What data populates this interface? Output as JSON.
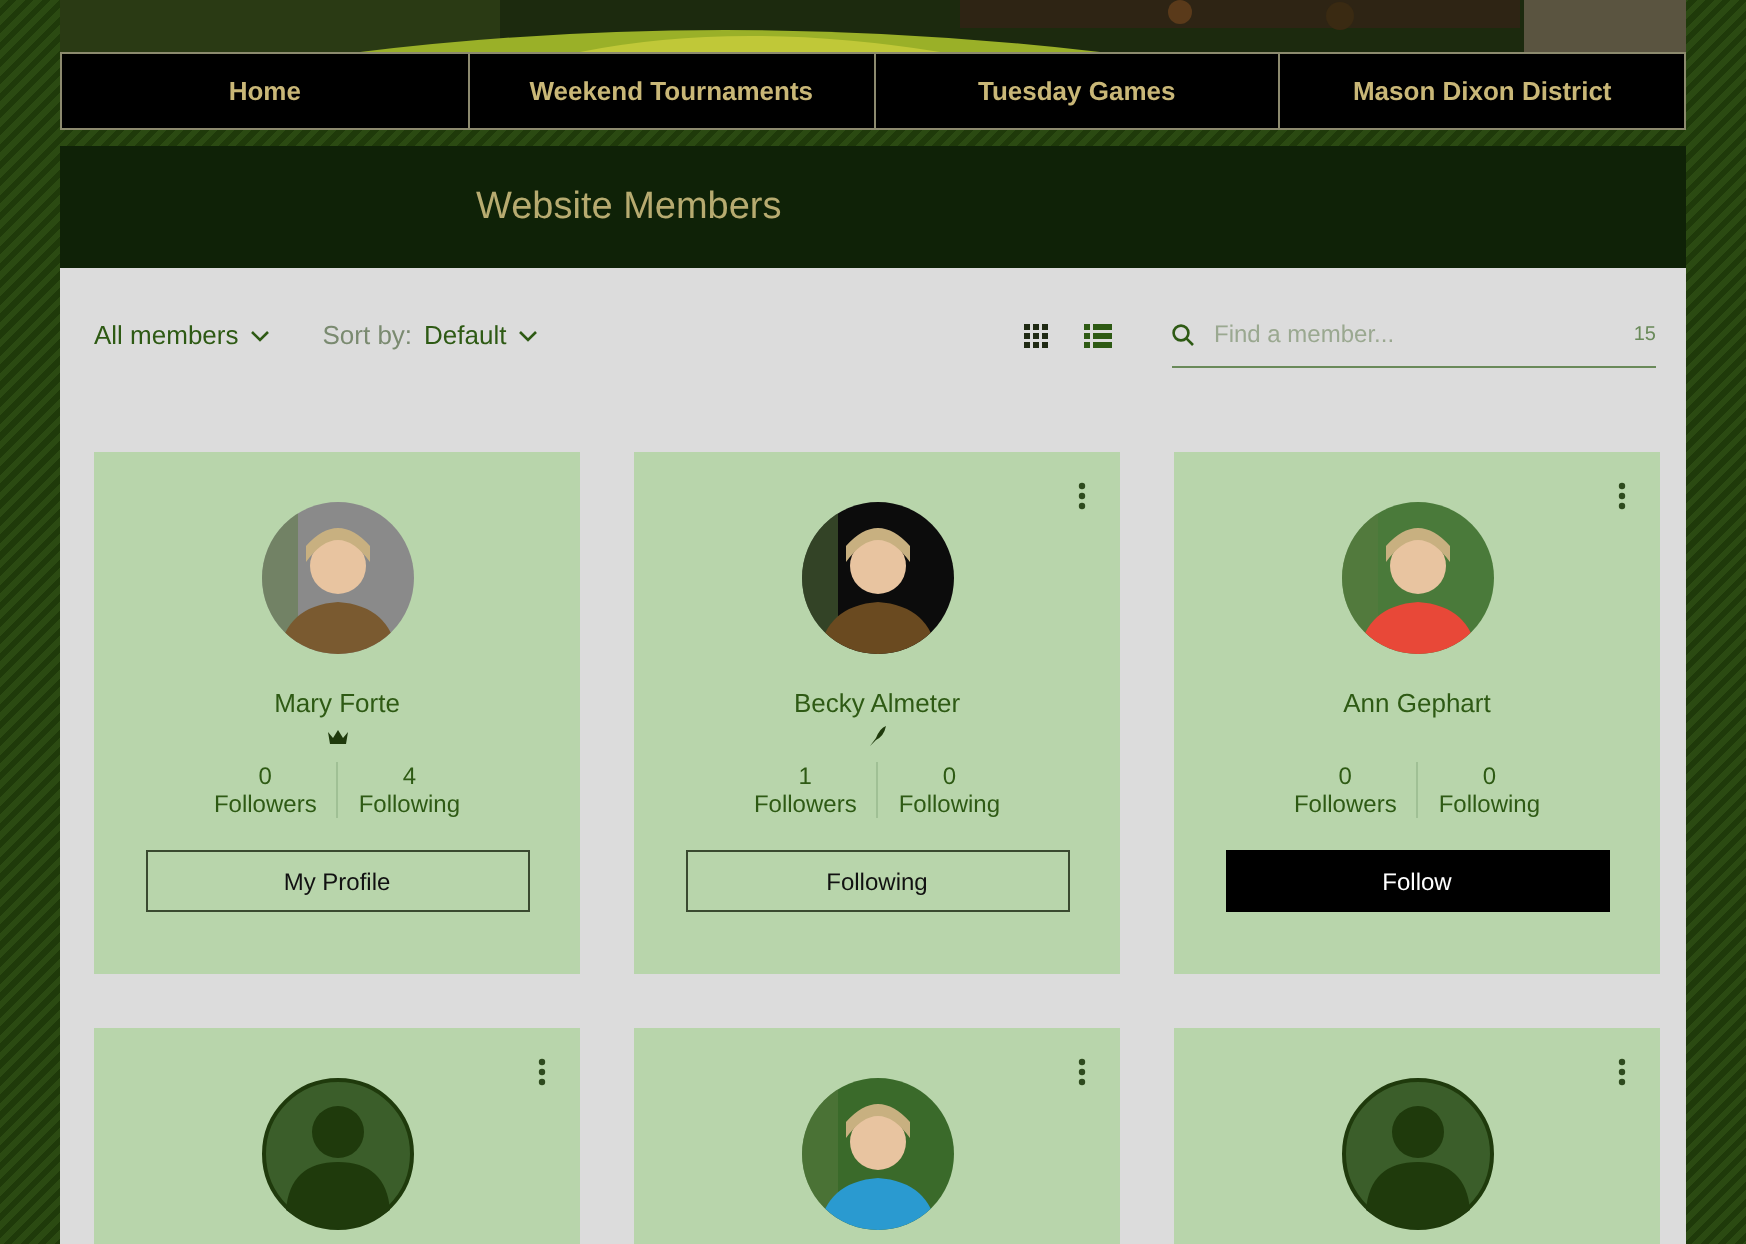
{
  "nav": [
    {
      "label": "Home"
    },
    {
      "label": "Weekend Tournaments"
    },
    {
      "label": "Tuesday Games"
    },
    {
      "label": "Mason Dixon District"
    }
  ],
  "header": {
    "title": "Website Members"
  },
  "toolbar": {
    "filter": "All members",
    "sort_label": "Sort by:",
    "sort_value": "Default",
    "search": {
      "placeholder": "Find a member..."
    },
    "count": "15"
  },
  "members": [
    {
      "name": "Mary Forte",
      "badge": {
        "kind": "crown"
      },
      "followers": "0",
      "followers_label": "Followers",
      "following": "4",
      "following_label": "Following",
      "button": {
        "label": "My Profile",
        "kind": "outline"
      },
      "menu": false
    },
    {
      "name": "Becky Almeter",
      "badge": {
        "kind": "feather"
      },
      "followers": "1",
      "followers_label": "Followers",
      "following": "0",
      "following_label": "Following",
      "button": {
        "label": "Following",
        "kind": "outline"
      },
      "menu": true
    },
    {
      "name": "Ann Gephart",
      "followers": "0",
      "followers_label": "Followers",
      "following": "0",
      "following_label": "Following",
      "button": {
        "label": "Follow",
        "kind": "solid"
      },
      "menu": true
    },
    {
      "avatar": {
        "kind": "default"
      },
      "menu": true
    },
    {
      "menu": true
    },
    {
      "avatar": {
        "kind": "default"
      },
      "menu": true
    }
  ]
}
